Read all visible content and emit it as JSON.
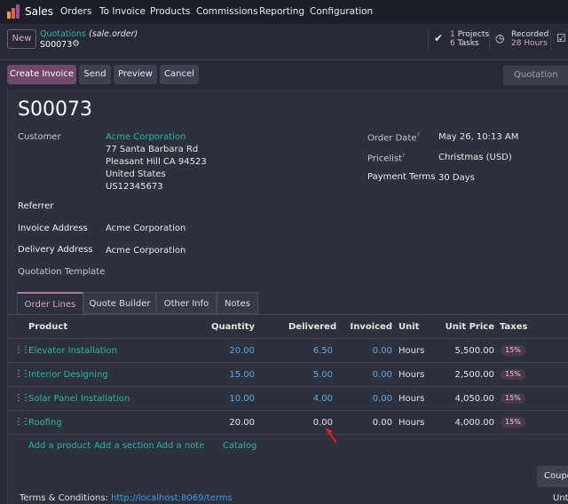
{
  "topbar": {
    "app": "Sales",
    "menu": [
      "Orders",
      "To Invoice",
      "Products",
      "Commissions",
      "Reporting",
      "Configuration"
    ]
  },
  "control_panel": {
    "new_label": "New",
    "breadcrumb_parent": "Quotations",
    "breadcrumb_model": "(sale.order)",
    "record_name": "S00073",
    "stat_projects_count": "1",
    "stat_projects_label": "Projects",
    "stat_tasks_count": "6",
    "stat_tasks_label": "Tasks",
    "stat_recorded_label": "Recorded",
    "stat_hours_value": "28 Hours"
  },
  "actions": {
    "create_invoice": "Create Invoice",
    "send": "Send",
    "preview": "Preview",
    "cancel": "Cancel",
    "status": "Quotation"
  },
  "form": {
    "title": "S00073",
    "customer_label": "Customer",
    "customer_name": "Acme Corporation",
    "address_line1": "77 Santa Barbara Rd",
    "address_line2": "Pleasant Hill CA 94523",
    "address_country": "United States",
    "address_vat": "US12345673",
    "referrer_label": "Referrer",
    "invoice_address_label": "Invoice Address",
    "invoice_address_value": "Acme Corporation",
    "delivery_address_label": "Delivery Address",
    "delivery_address_value": "Acme Corporation",
    "quotation_template_label": "Quotation Template",
    "order_date_label": "Order Date",
    "order_date_value": "May 26, 10:13 AM",
    "pricelist_label": "Pricelist",
    "pricelist_value": "Christmas (USD)",
    "payment_terms_label": "Payment Terms",
    "payment_terms_value": "30 Days",
    "help_mark": "?"
  },
  "tabs": [
    "Order Lines",
    "Quote Builder",
    "Other Info",
    "Notes"
  ],
  "table": {
    "headers": {
      "product": "Product",
      "quantity": "Quantity",
      "delivered": "Delivered",
      "invoiced": "Invoiced",
      "unit": "Unit",
      "unit_price": "Unit Price",
      "taxes": "Taxes"
    },
    "rows": [
      {
        "product": "Elevator Installation",
        "quantity": "20.00",
        "delivered": "6.50",
        "invoiced": "0.00",
        "unit": "Hours",
        "unit_price": "5,500.00",
        "tax": "15%"
      },
      {
        "product": "Interior Designing",
        "quantity": "15.00",
        "delivered": "5.00",
        "invoiced": "0.00",
        "unit": "Hours",
        "unit_price": "2,500.00",
        "tax": "15%"
      },
      {
        "product": "Solar Panel Installation",
        "quantity": "10.00",
        "delivered": "4.00",
        "invoiced": "0.00",
        "unit": "Hours",
        "unit_price": "4,050.00",
        "tax": "15%"
      },
      {
        "product": "Roofing",
        "quantity": "20.00",
        "delivered": "0.00",
        "invoiced": "0.00",
        "unit": "Hours",
        "unit_price": "4,000.00",
        "tax": "15%"
      }
    ],
    "add_product": "Add a product",
    "add_section": "Add a section",
    "add_note": "Add a note",
    "catalog": "Catalog"
  },
  "footer": {
    "coupon_label": "Coupo",
    "terms_label": "Terms & Conditions:",
    "terms_link": "http://localhost:8069/terms",
    "untaxed_label": "Unta"
  },
  "colors": {
    "accent": "#71486a",
    "link": "#29b6a8",
    "arrow": "#e0202a"
  }
}
